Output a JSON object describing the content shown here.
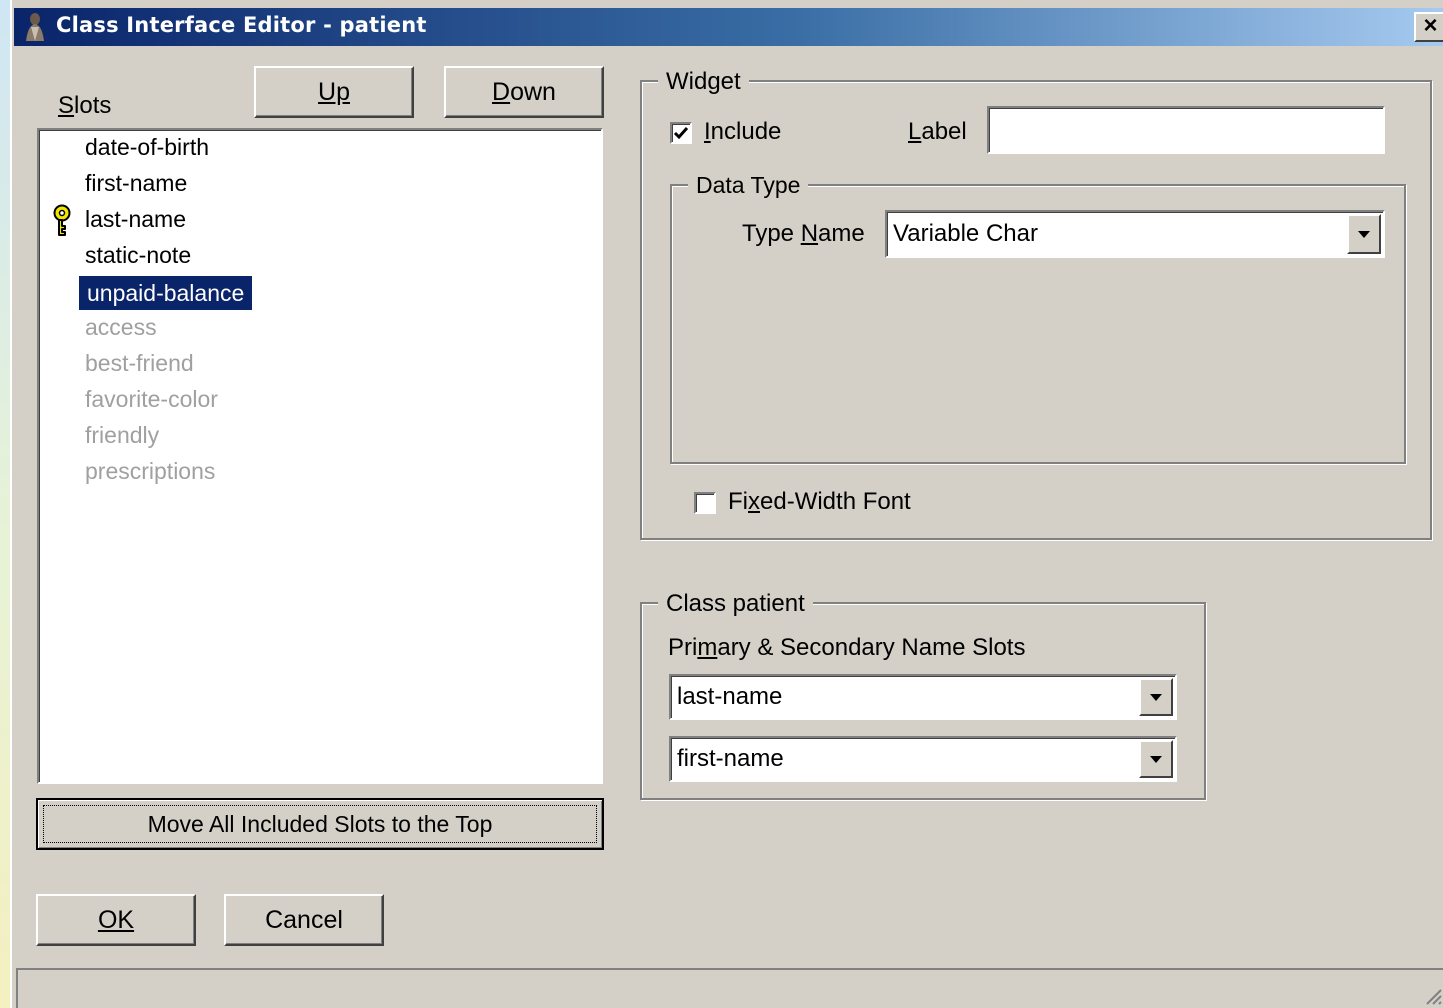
{
  "window": {
    "title": "Class Interface Editor - patient",
    "close_glyph": "×"
  },
  "slots": {
    "label": "Slots",
    "up_label": "Up",
    "down_label": "Down",
    "items": [
      {
        "name": "date-of-birth",
        "state": "included"
      },
      {
        "name": "first-name",
        "state": "included"
      },
      {
        "name": "last-name",
        "state": "key"
      },
      {
        "name": "static-note",
        "state": "included"
      },
      {
        "name": "unpaid-balance",
        "state": "selected"
      },
      {
        "name": "access",
        "state": "excluded"
      },
      {
        "name": "best-friend",
        "state": "excluded"
      },
      {
        "name": "favorite-color",
        "state": "excluded"
      },
      {
        "name": "friendly",
        "state": "excluded"
      },
      {
        "name": "prescriptions",
        "state": "excluded"
      }
    ],
    "move_all_label": "Move All Included Slots to the Top"
  },
  "widget": {
    "legend": "Widget",
    "include_label": "Include",
    "include_checked": true,
    "label_label": "Label",
    "label_value": "",
    "data_type": {
      "legend": "Data Type",
      "type_name_label": "Type Name",
      "type_name_value": "Variable Char"
    },
    "fixed_width_label": "Fixed-Width Font",
    "fixed_width_checked": false
  },
  "class_group": {
    "legend": "Class patient",
    "name_slots_label": "Primary & Secondary Name Slots",
    "primary_value": "last-name",
    "secondary_value": "first-name"
  },
  "buttons": {
    "ok_label": "OK",
    "cancel_label": "Cancel"
  },
  "colors": {
    "selection": "#0a246a",
    "dialog_bg": "#d4d0c8",
    "disabled_text": "#a0a0a0",
    "key_icon": "#e8d800"
  }
}
